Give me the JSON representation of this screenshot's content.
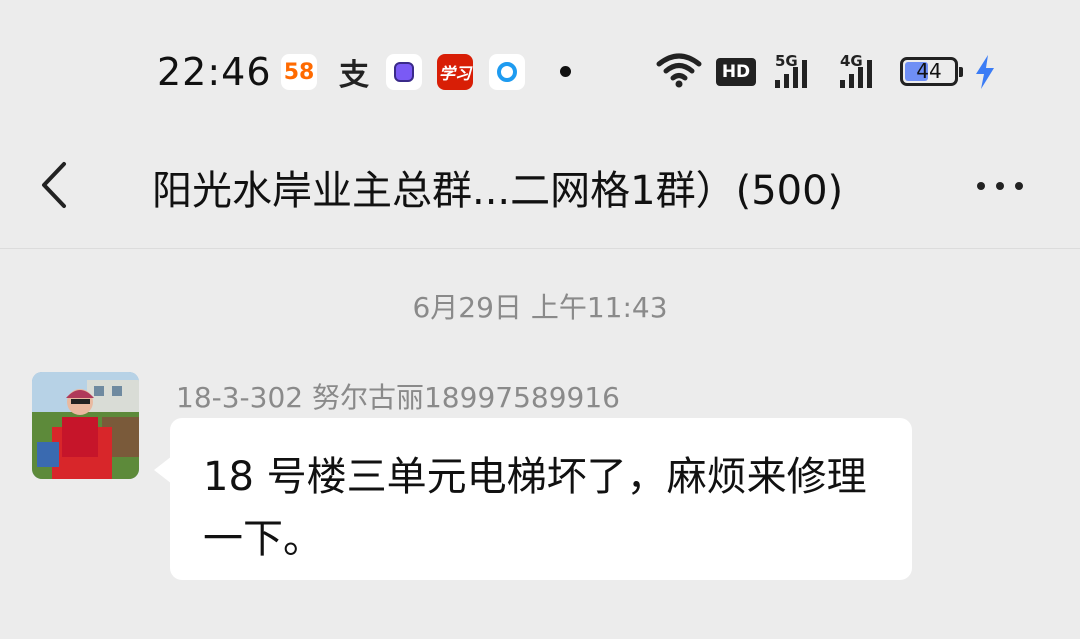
{
  "status_bar": {
    "time": "22:46",
    "app_58_label": "58",
    "alipay_label": "支",
    "xuexi_label": "学习",
    "hd_label": "HD",
    "sig1_label": "5G",
    "sig2_label": "4G",
    "battery_level": "44",
    "battery_fraction": 0.44
  },
  "header": {
    "title": "阳光水岸业主总群...二网格1群）(500)",
    "icons": [
      "back-arrow-icon",
      "more-options-icon"
    ]
  },
  "messages": {
    "timestamp": "6月29日 上午11:43",
    "sender": "18-3-302 努尔古丽18997589916",
    "text": "18 号楼三单元电梯坏了，麻烦来修理一下。"
  },
  "colors": {
    "background": "#ececec",
    "bubble": "#ffffff",
    "meta_text": "#8a8a8a",
    "battery_fill": "#6f8ff5",
    "bolt": "#3b7cf5"
  }
}
